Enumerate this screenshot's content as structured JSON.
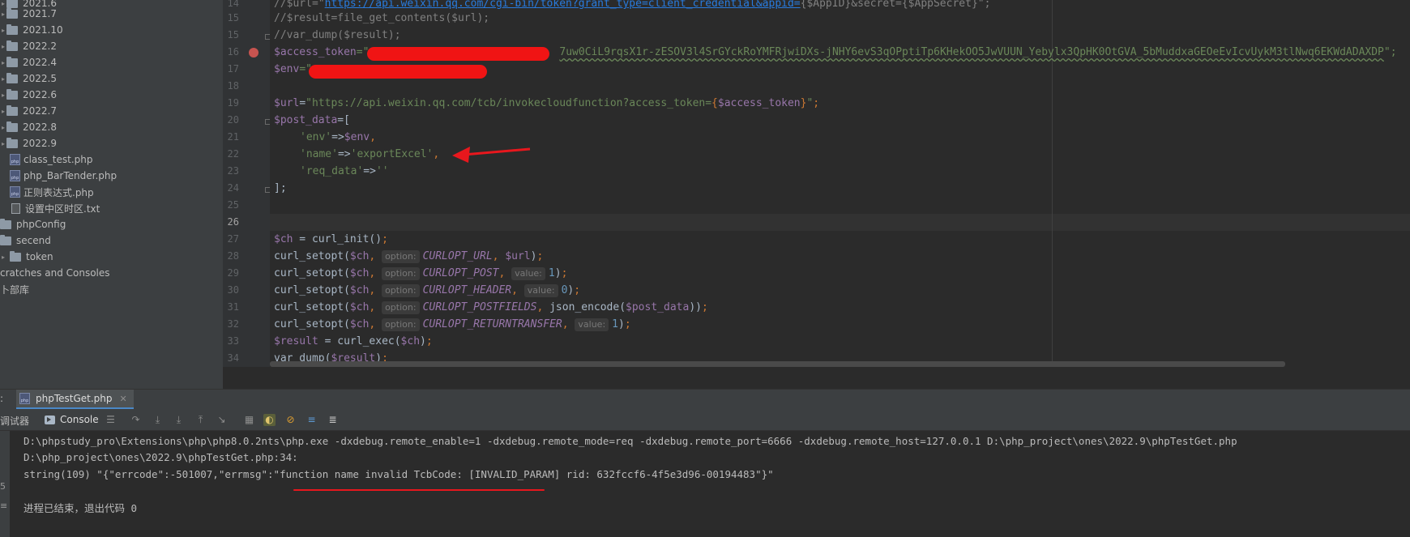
{
  "project_tree": {
    "items": [
      {
        "label": "2021.6",
        "type": "folder"
      },
      {
        "label": "2021.7",
        "type": "folder"
      },
      {
        "label": "2021.10",
        "type": "folder"
      },
      {
        "label": "2022.2",
        "type": "folder"
      },
      {
        "label": "2022.4",
        "type": "folder"
      },
      {
        "label": "2022.5",
        "type": "folder"
      },
      {
        "label": "2022.6",
        "type": "folder"
      },
      {
        "label": "2022.7",
        "type": "folder"
      },
      {
        "label": "2022.8",
        "type": "folder"
      },
      {
        "label": "2022.9",
        "type": "folder"
      },
      {
        "label": "class_test.php",
        "type": "php"
      },
      {
        "label": "php_BarTender.php",
        "type": "php"
      },
      {
        "label": "正则表达式.php",
        "type": "php"
      },
      {
        "label": "设置中区时区.txt",
        "type": "txt"
      },
      {
        "label": "phpConfig",
        "type": "folder"
      },
      {
        "label": "secend",
        "type": "folder"
      },
      {
        "label": "token",
        "type": "folder"
      },
      {
        "label": "cratches and Consoles",
        "type": "scratch"
      },
      {
        "label": "卜部库",
        "type": "lib"
      }
    ]
  },
  "editor": {
    "line_numbers": [
      "14",
      "15",
      "15",
      "16",
      "17",
      "18",
      "19",
      "20",
      "21",
      "22",
      "23",
      "24",
      "25",
      "26",
      "27",
      "28",
      "29",
      "30",
      "31",
      "32",
      "33",
      "34"
    ],
    "lines": {
      "l13_a": "//$url=\"",
      "l13_link": "https://api.weixin.qq.com/cgi-bin/token?grant_type=client_credential&appid=",
      "l13_b": "{$AppID}&secret={$AppSecret}\";",
      "l14": "//$result=file_get_contents($url);",
      "l15": "//var_dump($result);",
      "l16_var": "$access_token",
      "l16_eq": "=\"",
      "l16_tok": "7uw0CiL9rqsX1r-zESOV3l4SrGYckRoYMFRjwiDXs-jNHY6evS3qOPptiTp6KHekOO5JwVUUN_Yebylx3QpHK0OtGVA_5bMuddxaGEOeEvIcvUykM3tlNwq6EKWdADAXDP",
      "l16_end": "\";",
      "l17_var": "$env",
      "l17_eq": "=\"",
      "l19_var": "$url",
      "l19_eq": "=",
      "l19_str": "\"https://api.weixin.qq.com/tcb/invokecloudfunction?access_token=",
      "l19_br": "{",
      "l19_var2": "$access_token",
      "l19_br2": "}",
      "l19_end": "\"",
      "l19_semi": ";",
      "l20_var": "$post_data",
      "l20_rest": "=[",
      "l21_key": "'env'",
      "l21_arrow": "=>",
      "l21_var": "$env",
      "l21_comma": ",",
      "l22_key": "'name'",
      "l22_arrow": "=>",
      "l22_val": "'exportExcel'",
      "l22_comma": ",",
      "l23_key": "'req_data'",
      "l23_arrow": "=>",
      "l23_val": "''",
      "l24": "];",
      "l27_var": "$ch",
      "l27_rest": " = curl_init()",
      "l27_semi": ";",
      "hint_option": "option:",
      "hint_value": "value:",
      "curl_setopt": "curl_setopt(",
      "ch": "$ch",
      "comma": ", ",
      "c28": "CURLOPT_URL",
      "v28": "$url",
      "c29": "CURLOPT_POST",
      "v29": "1",
      "c30": "CURLOPT_HEADER",
      "v30": "0",
      "c31": "CURLOPT_POSTFIELDS",
      "v31_fn": "json_encode(",
      "v31_var": "$post_data",
      "v31_close": "))",
      "c32": "CURLOPT_RETURNTRANSFER",
      "v32": "1",
      "close": ")",
      "semi": ";",
      "l33_var": "$result",
      "l33_rest": " = curl_exec(",
      "l33_var2": "$ch",
      "l34_fn": "var_dump(",
      "l34_var": "$result"
    }
  },
  "run_window": {
    "left_label": ":",
    "tab_label": "phpTestGet.php",
    "debugger_label": "调试器",
    "console_label": "Console",
    "output": [
      "D:\\phpstudy_pro\\Extensions\\php\\php8.0.2nts\\php.exe -dxdebug.remote_enable=1 -dxdebug.remote_mode=req -dxdebug.remote_port=6666 -dxdebug.remote_host=127.0.0.1 D:\\php_project\\ones\\2022.9\\phpTestGet.php",
      "D:\\php_project\\ones\\2022.9\\phpTestGet.php:34:",
      "string(109) \"{\"errcode\":-501007,\"errmsg\":\"function name invalid TcbCode: [INVALID_PARAM] rid: 632fccf6-4f5e3d96-00194483\"}\"",
      "",
      "进程已结束，退出代码 0"
    ],
    "gutter_marks": [
      "5",
      "≡"
    ]
  },
  "colors": {
    "annotation_red": "#e8171d"
  }
}
